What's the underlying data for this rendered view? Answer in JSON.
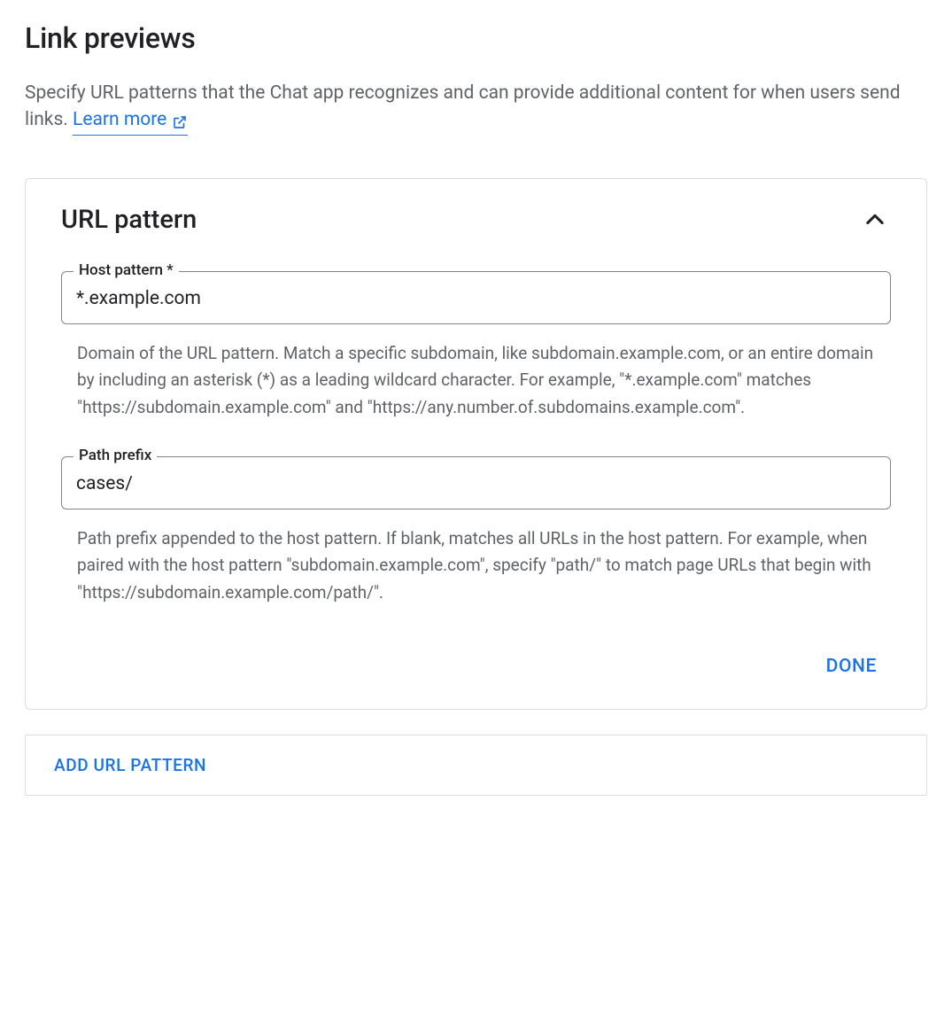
{
  "header": {
    "title": "Link previews",
    "description": "Specify URL patterns that the Chat app recognizes and can provide additional content for when users send links. ",
    "learn_more_label": "Learn more"
  },
  "card": {
    "title": "URL pattern",
    "fields": {
      "host_pattern": {
        "label": "Host pattern *",
        "value": "*.example.com",
        "helper": "Domain of the URL pattern. Match a specific subdomain, like subdomain.example.com, or an entire domain by including an asterisk (*) as a leading wildcard character. For example, \"*.example.com\" matches \"https://subdomain.example.com\" and \"https://any.number.of.subdomains.example.com\"."
      },
      "path_prefix": {
        "label": "Path prefix",
        "value": "cases/",
        "helper": "Path prefix appended to the host pattern. If blank, matches all URLs in the host pattern. For example, when paired with the host pattern \"subdomain.example.com\", specify \"path/\" to match page URLs that begin with \"https://subdomain.example.com/path/\"."
      }
    },
    "done_label": "DONE"
  },
  "add_button": {
    "label": "ADD URL PATTERN"
  }
}
